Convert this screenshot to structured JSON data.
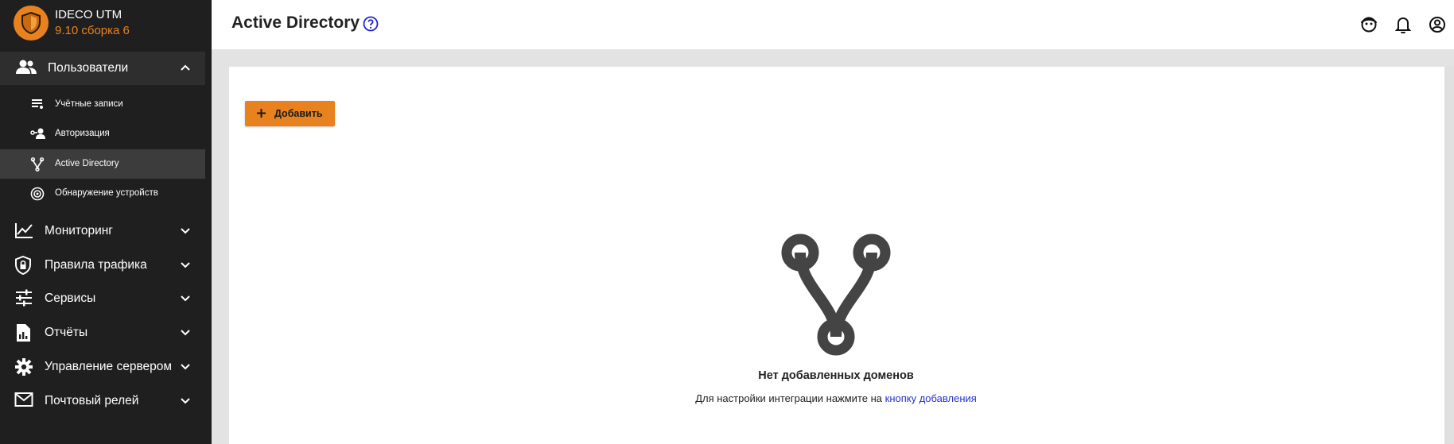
{
  "app": {
    "name": "IDECO UTM",
    "version": "9.10 сборка 6",
    "accent_color": "#e8821e"
  },
  "sidebar": {
    "open_section": {
      "label": "Пользователи",
      "icon": "users-icon"
    },
    "sub_items": [
      {
        "label": "Учётные записи",
        "icon": "accounts-list-icon",
        "active": false
      },
      {
        "label": "Авторизация",
        "icon": "authorization-icon",
        "active": false
      },
      {
        "label": "Active Directory",
        "icon": "branch-icon",
        "active": true
      },
      {
        "label": "Обнаружение устройств",
        "icon": "radar-icon",
        "active": false
      }
    ],
    "sections": [
      {
        "label": "Мониторинг",
        "icon": "chart-line-icon"
      },
      {
        "label": "Правила трафика",
        "icon": "shield-lock-icon"
      },
      {
        "label": "Сервисы",
        "icon": "sliders-icon"
      },
      {
        "label": "Отчёты",
        "icon": "report-icon"
      },
      {
        "label": "Управление сервером",
        "icon": "gear-icon"
      },
      {
        "label": "Почтовый релей",
        "icon": "mail-icon"
      }
    ]
  },
  "header": {
    "title": "Active Directory",
    "help_icon": "help-circle-icon",
    "icons": [
      "support-icon",
      "bell-icon",
      "account-circle-icon"
    ]
  },
  "toolbar": {
    "add_label": "Добавить"
  },
  "empty_state": {
    "icon": "branch-icon",
    "title": "Нет добавленных доменов",
    "description": "Для настройки интеграции нажмите на ",
    "link": "кнопку добавления"
  }
}
